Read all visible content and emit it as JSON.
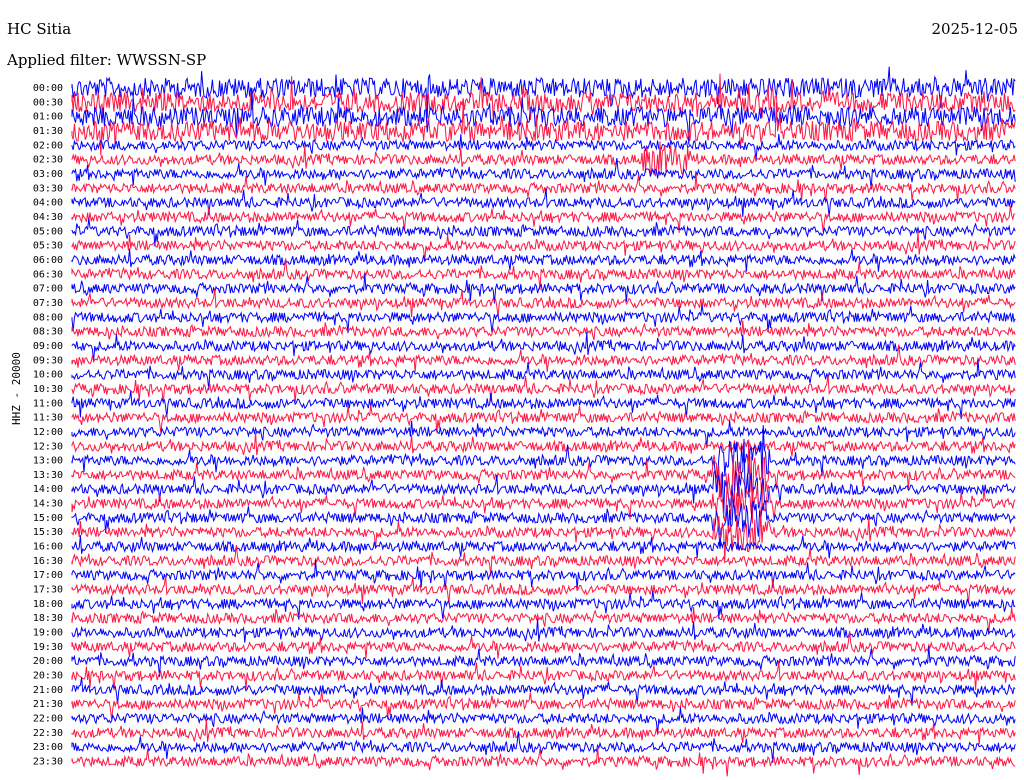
{
  "station": "HC Sitia",
  "date": "2025-12-05",
  "filter": "Applied filter: WWSSN-SP",
  "channel": "HHZ - 20000",
  "colors": {
    "odd": "#0000ff",
    "even": "#ff1744",
    "background": "#ffffff"
  },
  "chart_data": {
    "type": "helicorder",
    "title": "HC Sitia",
    "row_labels": [
      "00:00",
      "00:30",
      "01:00",
      "01:30",
      "02:00",
      "02:30",
      "03:00",
      "03:30",
      "04:00",
      "04:30",
      "05:00",
      "05:30",
      "06:00",
      "06:30",
      "07:00",
      "07:30",
      "08:00",
      "08:30",
      "09:00",
      "09:30",
      "10:00",
      "10:30",
      "11:00",
      "11:30",
      "12:00",
      "12:30",
      "13:00",
      "13:30",
      "14:00",
      "14:30",
      "15:00",
      "15:30",
      "16:00",
      "16:30",
      "17:00",
      "17:30",
      "18:00",
      "18:30",
      "19:00",
      "19:30",
      "20:00",
      "20:30",
      "21:00",
      "21:30",
      "22:00",
      "22:30",
      "23:00",
      "23:30"
    ],
    "ylabel": "HHZ - 20000",
    "row_minutes": 30,
    "alternating_colors": [
      "blue",
      "red"
    ]
  }
}
